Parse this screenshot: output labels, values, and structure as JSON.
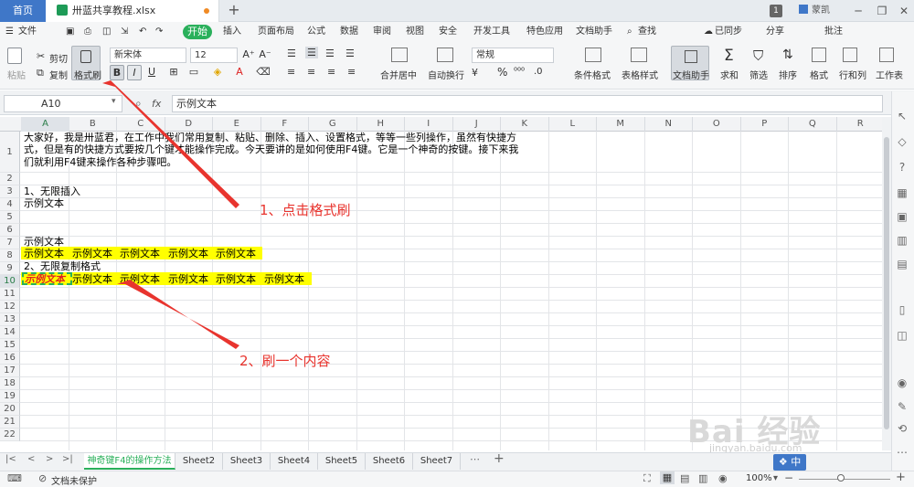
{
  "titlebar": {
    "home_tab": "首页",
    "file_name": "卅蓝共享教程.xlsx",
    "new_tab": "+",
    "badge": "1",
    "user": "蒙凯"
  },
  "menu": {
    "file": "文件",
    "start": "开始",
    "insert": "插入",
    "page_layout": "页面布局",
    "formula": "公式",
    "data": "数据",
    "review": "审阅",
    "view": "视图",
    "security": "安全",
    "dev_tools": "开发工具",
    "special": "特色应用",
    "doc_helper": "文档助手",
    "search": "查找",
    "sync": "已同步",
    "share": "分享",
    "comment": "批注"
  },
  "ribbon": {
    "paste": "粘贴",
    "cut": "剪切",
    "copy": "复制",
    "format_painter": "格式刷",
    "font_name": "新宋体",
    "font_size": "12",
    "bold": "B",
    "italic": "I",
    "underline": "U",
    "merge_center": "合并居中",
    "auto_wrap": "自动换行",
    "number_format": "常规",
    "percent": "%",
    "cond_format": "条件格式",
    "table_style": "表格样式",
    "doc_helper": "文档助手",
    "sum": "求和",
    "filter": "筛选",
    "sort": "排序",
    "format": "格式",
    "rowcol": "行和列",
    "worksheet": "工作表"
  },
  "formula_bar": {
    "name_box": "A10",
    "fx": "fx",
    "value": "示例文本"
  },
  "columns": [
    "A",
    "B",
    "C",
    "D",
    "E",
    "F",
    "G",
    "H",
    "I",
    "J",
    "K",
    "L",
    "M",
    "N",
    "O",
    "P",
    "Q",
    "R"
  ],
  "rows": [
    "1",
    "2",
    "3",
    "4",
    "5",
    "6",
    "7",
    "8",
    "9",
    "10",
    "11",
    "12",
    "13",
    "14",
    "15",
    "16",
    "17",
    "18",
    "19",
    "20",
    "21",
    "22"
  ],
  "cells": {
    "r1_line1": "大家好，我是卅蓝君，在工作中我们常用复制、粘贴、删除、插入、设置格式，等等一些列操作，虽然有快捷方",
    "r1_line2": "式，但是有的快捷方式要按几个键才能操作完成。今天要讲的是如何使用F4键。它是一个神奇的按键。接下来我",
    "r1_line3": "们就利用F4键来操作各种步骤吧。",
    "a3": "1、无限插入",
    "a4": "示例文本",
    "a7": "示例文本",
    "r8": [
      "示例文本",
      "示例文本",
      "示例文本",
      "示例文本",
      "示例文本"
    ],
    "a9": "2、无限复制格式",
    "a10": "示例文本",
    "r10": [
      "示例文本",
      "示例文本",
      "示例文本",
      "示例文本",
      "示例文本"
    ]
  },
  "annotations": {
    "step1": "1、点击格式刷",
    "step2": "2、刷一个内容"
  },
  "sheets": [
    "神奇键F4的操作方法",
    "Sheet2",
    "Sheet3",
    "Sheet4",
    "Sheet5",
    "Sheet6",
    "Sheet7"
  ],
  "status": {
    "protect": "文档未保护",
    "zoom": "100%",
    "ime": "中"
  },
  "watermark": {
    "text": "Bai 经验",
    "url": "jingyan.baidu.com"
  },
  "colors": {
    "accent": "#2ab05b",
    "highlight": "#ffff00",
    "annotation": "#e8342e"
  }
}
